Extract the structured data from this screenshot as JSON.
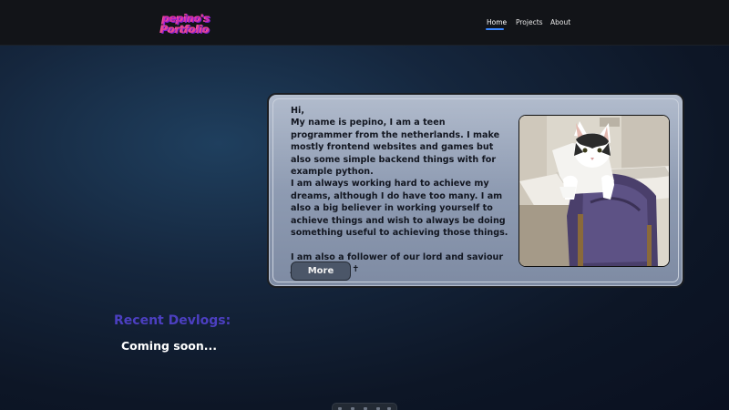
{
  "header": {
    "logo_line1": "pepino's",
    "logo_line2": "Portfolio",
    "nav": [
      {
        "label": "Home",
        "active": true
      },
      {
        "label": "Projects",
        "active": false
      },
      {
        "label": "About",
        "active": false
      }
    ]
  },
  "about_card": {
    "bio": "Hi,\nMy name is pepino, I am a teen programmer from the netherlands. I make mostly frontend websites and games but also some simple backend things with for example python.\nI am always working hard to achieve my dreams, although I do have too many. I am also a big believer in working yourself to achieve things and wish to always be doing something useful to achieving those things.\n\nI am also a follower of our lord and saviour Jesus Christ ✝",
    "more_label": "More",
    "photo_icon": "cat-photo"
  },
  "devlogs": {
    "title": "Recent Devlogs:",
    "status": "Coming soon..."
  },
  "colors": {
    "accent": "#3a86ff",
    "section_title": "#4c3fc1",
    "logo": "#d62fa8"
  }
}
